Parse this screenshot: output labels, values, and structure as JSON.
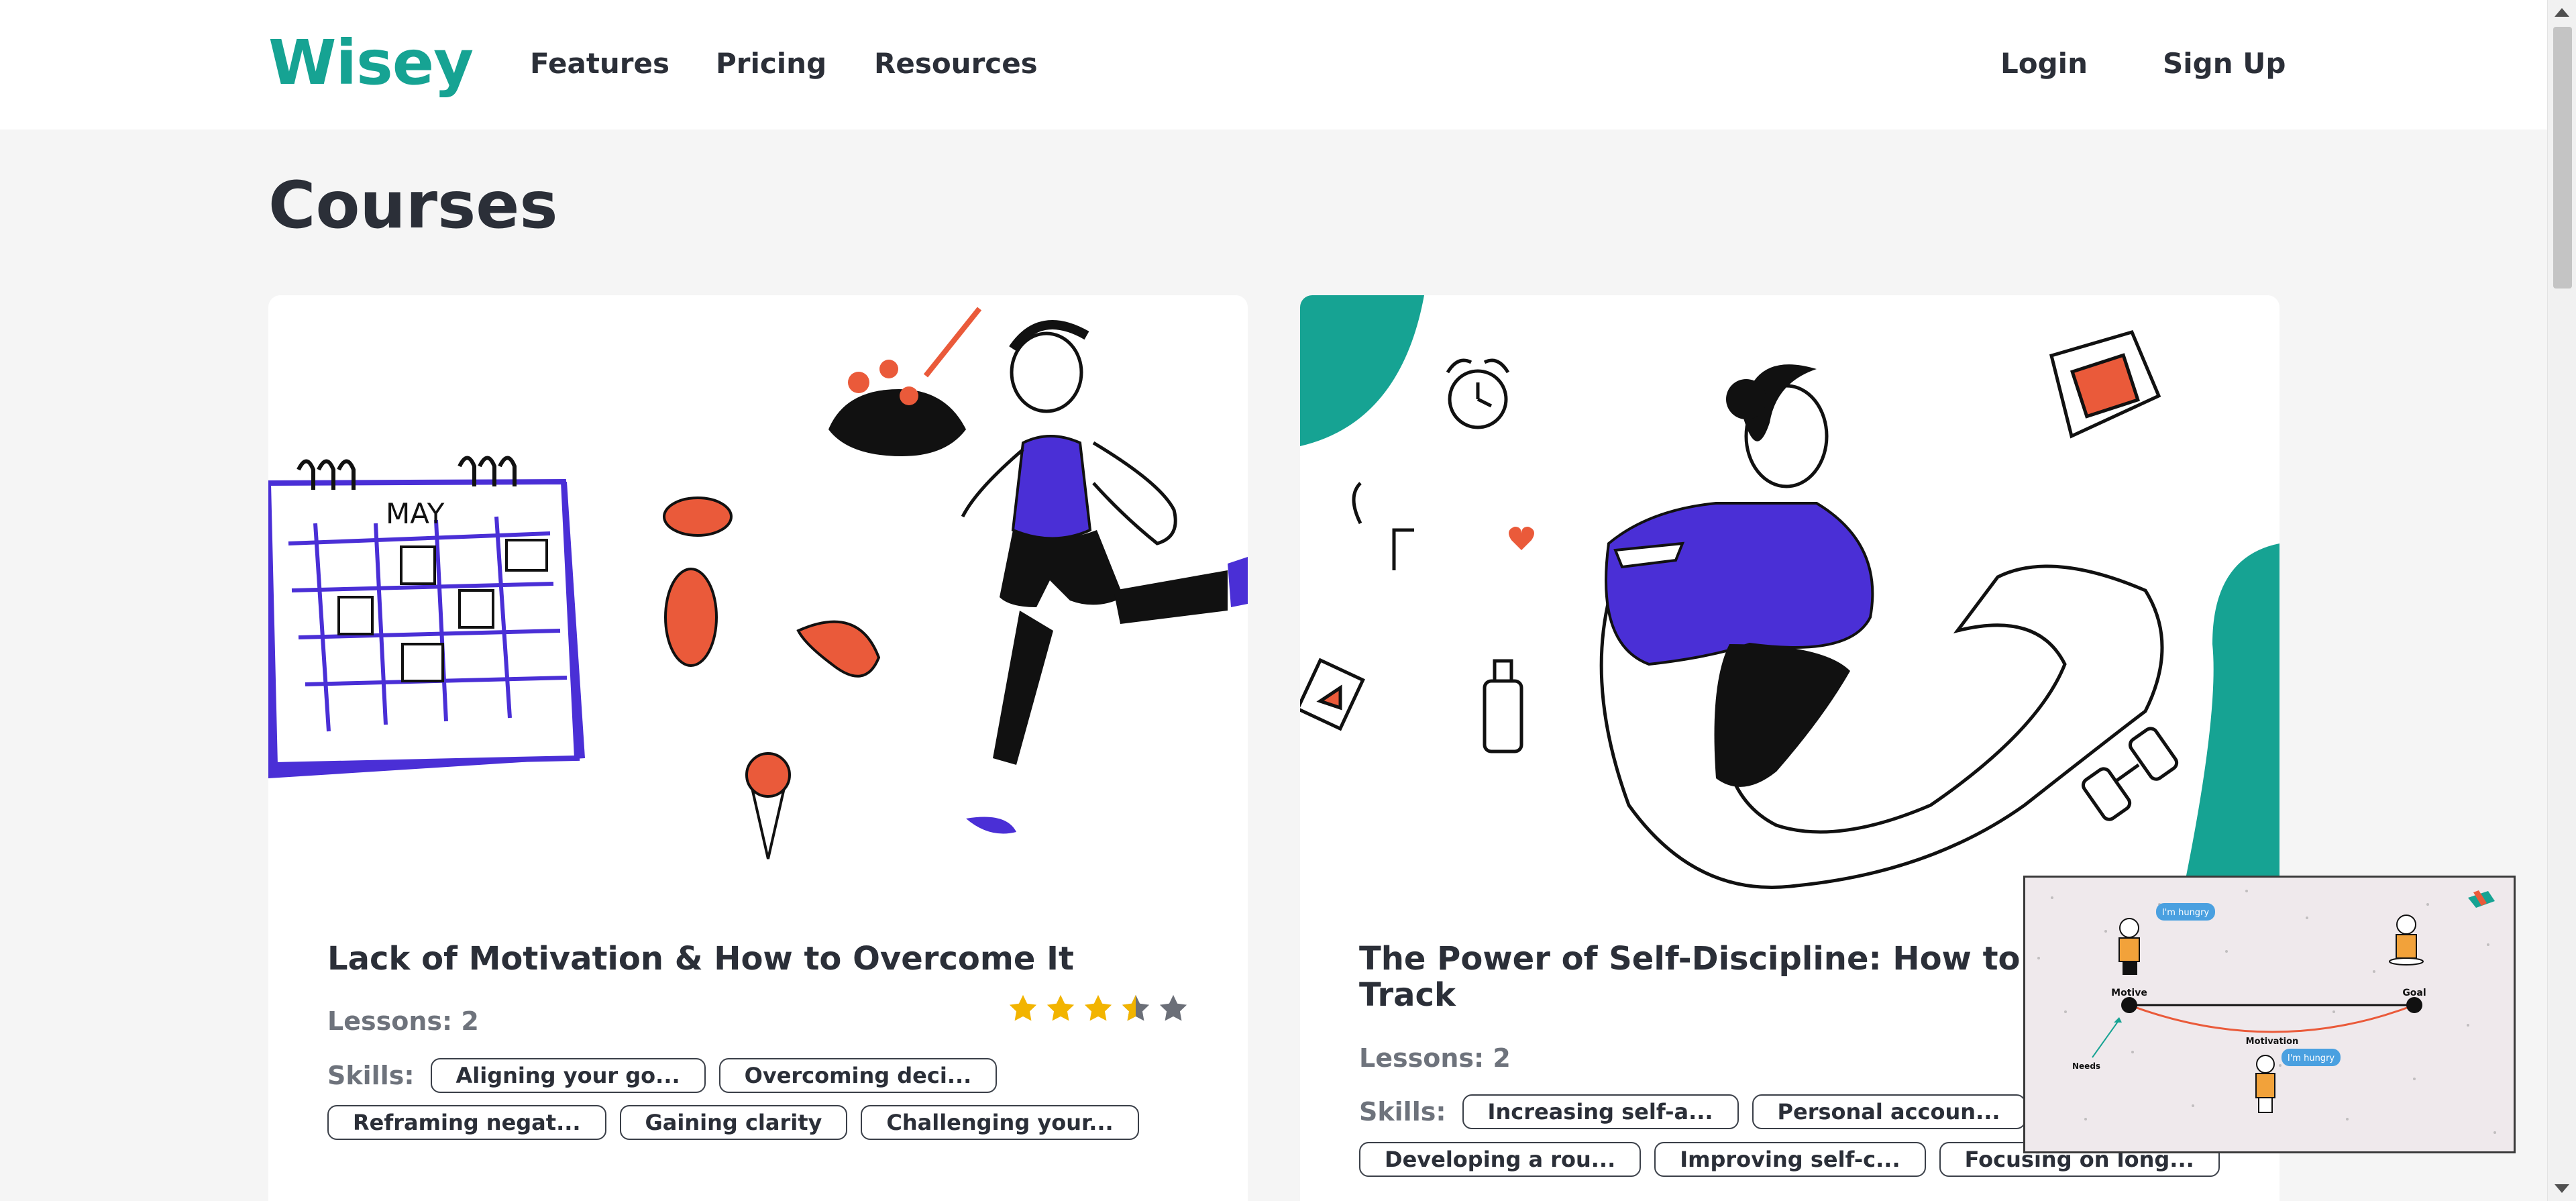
{
  "header": {
    "logo": "Wisey",
    "nav": [
      "Features",
      "Pricing",
      "Resources"
    ],
    "login": "Login",
    "signup": "Sign Up"
  },
  "page": {
    "title": "Courses"
  },
  "courses": [
    {
      "title": "Lack of Motivation & How to Overcome It",
      "lessons": "Lessons: 2",
      "rating": 3.5,
      "skills_label": "Skills:",
      "skills": [
        "Aligning your go...",
        "Overcoming deci...",
        "Reframing negat...",
        "Gaining clarity",
        "Challenging your..."
      ]
    },
    {
      "title": "The Power of Self-Discipline: How to Stay on Track",
      "lessons": "Lessons: 2",
      "skills_label": "Skills:",
      "skills": [
        "Increasing self-a...",
        "Personal accoun...",
        "Developing a rou...",
        "Improving self-c...",
        "Focusing on long..."
      ]
    }
  ],
  "popup": {
    "bubble1": "I'm hungry",
    "bubble2": "I'm hungry",
    "bubble3": "I'm hungry",
    "motive": "Motive",
    "goal": "Goal",
    "motivation": "Motivation",
    "needs": "Needs"
  },
  "colors": {
    "brand": "#16a393",
    "accent_purple": "#4a2fd6",
    "accent_orange": "#ea5a3a",
    "star": "#f2b400",
    "star_empty": "#6b6f78"
  }
}
